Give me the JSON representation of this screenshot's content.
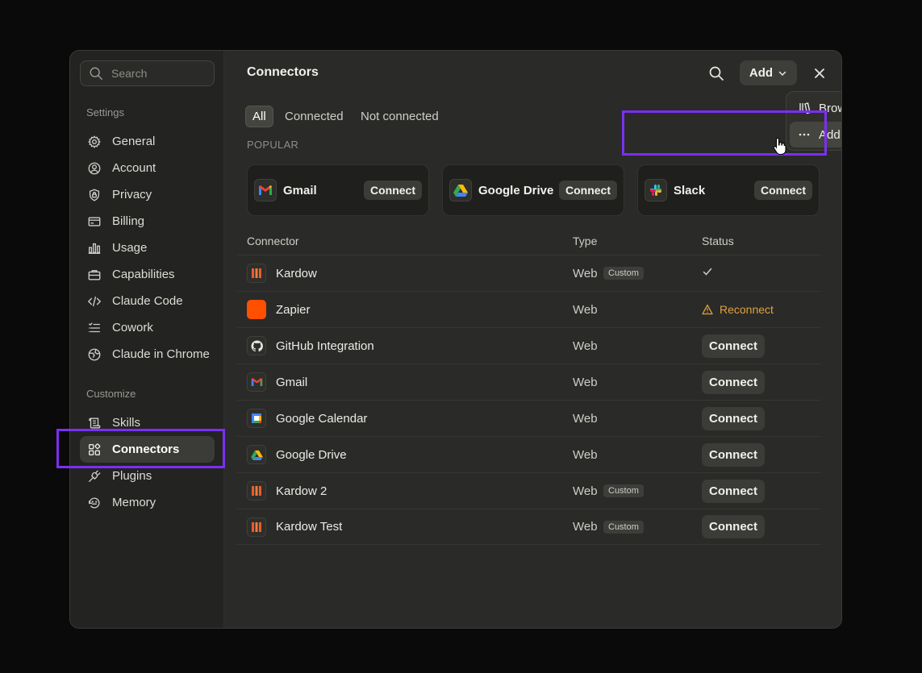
{
  "search": {
    "placeholder": "Search"
  },
  "sidebar": {
    "settings_label": "Settings",
    "customize_label": "Customize",
    "settings_items": [
      {
        "label": "General",
        "icon": "gear-icon"
      },
      {
        "label": "Account",
        "icon": "user-icon"
      },
      {
        "label": "Privacy",
        "icon": "shield-icon"
      },
      {
        "label": "Billing",
        "icon": "card-icon"
      },
      {
        "label": "Usage",
        "icon": "bar-chart-icon"
      },
      {
        "label": "Capabilities",
        "icon": "briefcase-icon"
      },
      {
        "label": "Claude Code",
        "icon": "code-icon"
      },
      {
        "label": "Cowork",
        "icon": "checklist-icon"
      },
      {
        "label": "Claude in Chrome",
        "icon": "globe-icon"
      }
    ],
    "customize_items": [
      {
        "label": "Skills",
        "icon": "scroll-icon"
      },
      {
        "label": "Connectors",
        "icon": "connectors-icon",
        "active": true
      },
      {
        "label": "Plugins",
        "icon": "plug-icon"
      },
      {
        "label": "Memory",
        "icon": "memory-icon"
      }
    ]
  },
  "header": {
    "title": "Connectors",
    "add_label": "Add"
  },
  "filters": [
    "All",
    "Connected",
    "Not connected"
  ],
  "popular_label": "POPULAR",
  "popular": [
    {
      "name": "Gmail",
      "icon": "gmail-icon",
      "button": "Connect"
    },
    {
      "name": "Google Drive",
      "icon": "google-drive-icon",
      "button": "Connect"
    },
    {
      "name": "Slack",
      "icon": "slack-icon",
      "button": "Connect"
    }
  ],
  "table": {
    "columns": [
      "Connector",
      "Type",
      "Status"
    ],
    "rows": [
      {
        "name": "Kardow",
        "type": "Web",
        "badge": "Custom",
        "status": "connected",
        "icon": "kardow-icon"
      },
      {
        "name": "Zapier",
        "type": "Web",
        "badge": "",
        "status": "Reconnect",
        "icon": "zapier-icon"
      },
      {
        "name": "GitHub Integration",
        "type": "Web",
        "badge": "",
        "status": "Connect",
        "icon": "github-icon"
      },
      {
        "name": "Gmail",
        "type": "Web",
        "badge": "",
        "status": "Connect",
        "icon": "gmail-icon"
      },
      {
        "name": "Google Calendar",
        "type": "Web",
        "badge": "",
        "status": "Connect",
        "icon": "google-calendar-icon"
      },
      {
        "name": "Google Drive",
        "type": "Web",
        "badge": "",
        "status": "Connect",
        "icon": "google-drive-icon"
      },
      {
        "name": "Kardow 2",
        "type": "Web",
        "badge": "Custom",
        "status": "Connect",
        "icon": "kardow-icon"
      },
      {
        "name": "Kardow Test",
        "type": "Web",
        "badge": "Custom",
        "status": "Connect",
        "icon": "kardow-icon"
      }
    ]
  },
  "dropdown": {
    "items": [
      {
        "label": "Browse connectors",
        "icon": "library-icon"
      },
      {
        "label": "Add custom connector",
        "icon": "more-horizontal-icon"
      }
    ]
  },
  "colors": {
    "highlight": "#7b2ff2",
    "warning": "#e2a23b",
    "zapier": "#ff4f00"
  }
}
